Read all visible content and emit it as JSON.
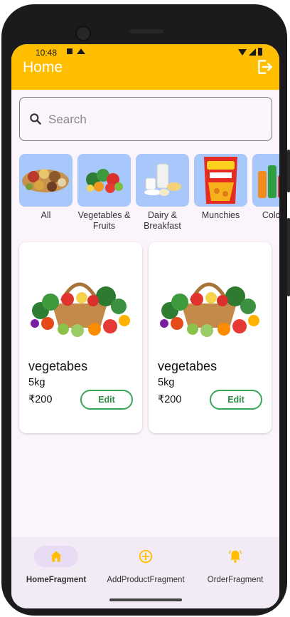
{
  "status_bar": {
    "time": "10:48"
  },
  "app_bar": {
    "title": "Home",
    "logout_icon": "logout-icon"
  },
  "search": {
    "placeholder": "Search",
    "icon": "search-icon"
  },
  "categories": [
    {
      "label": "All"
    },
    {
      "label": "Vegetables & Fruits"
    },
    {
      "label": "Dairy & Breakfast"
    },
    {
      "label": "Munchies"
    },
    {
      "label": "Cold & J"
    }
  ],
  "products": [
    {
      "name": "vegetabes",
      "weight": "5kg",
      "price": "₹200",
      "action": "Edit"
    },
    {
      "name": "vegetabes",
      "weight": "5kg",
      "price": "₹200",
      "action": "Edit"
    }
  ],
  "bottom_nav": [
    {
      "label": "HomeFragment",
      "icon": "home-icon",
      "selected": true
    },
    {
      "label": "AddProductFragment",
      "icon": "add-circle-icon",
      "selected": false
    },
    {
      "label": "OrderFragment",
      "icon": "bell-icon",
      "selected": false
    }
  ],
  "colors": {
    "app_bar": "#ffbf00",
    "category_bg": "#a8c7fa",
    "edit_border": "#3aa655",
    "nav_selected": "#e8dcf5",
    "nav_icon": "#ffbf00"
  }
}
